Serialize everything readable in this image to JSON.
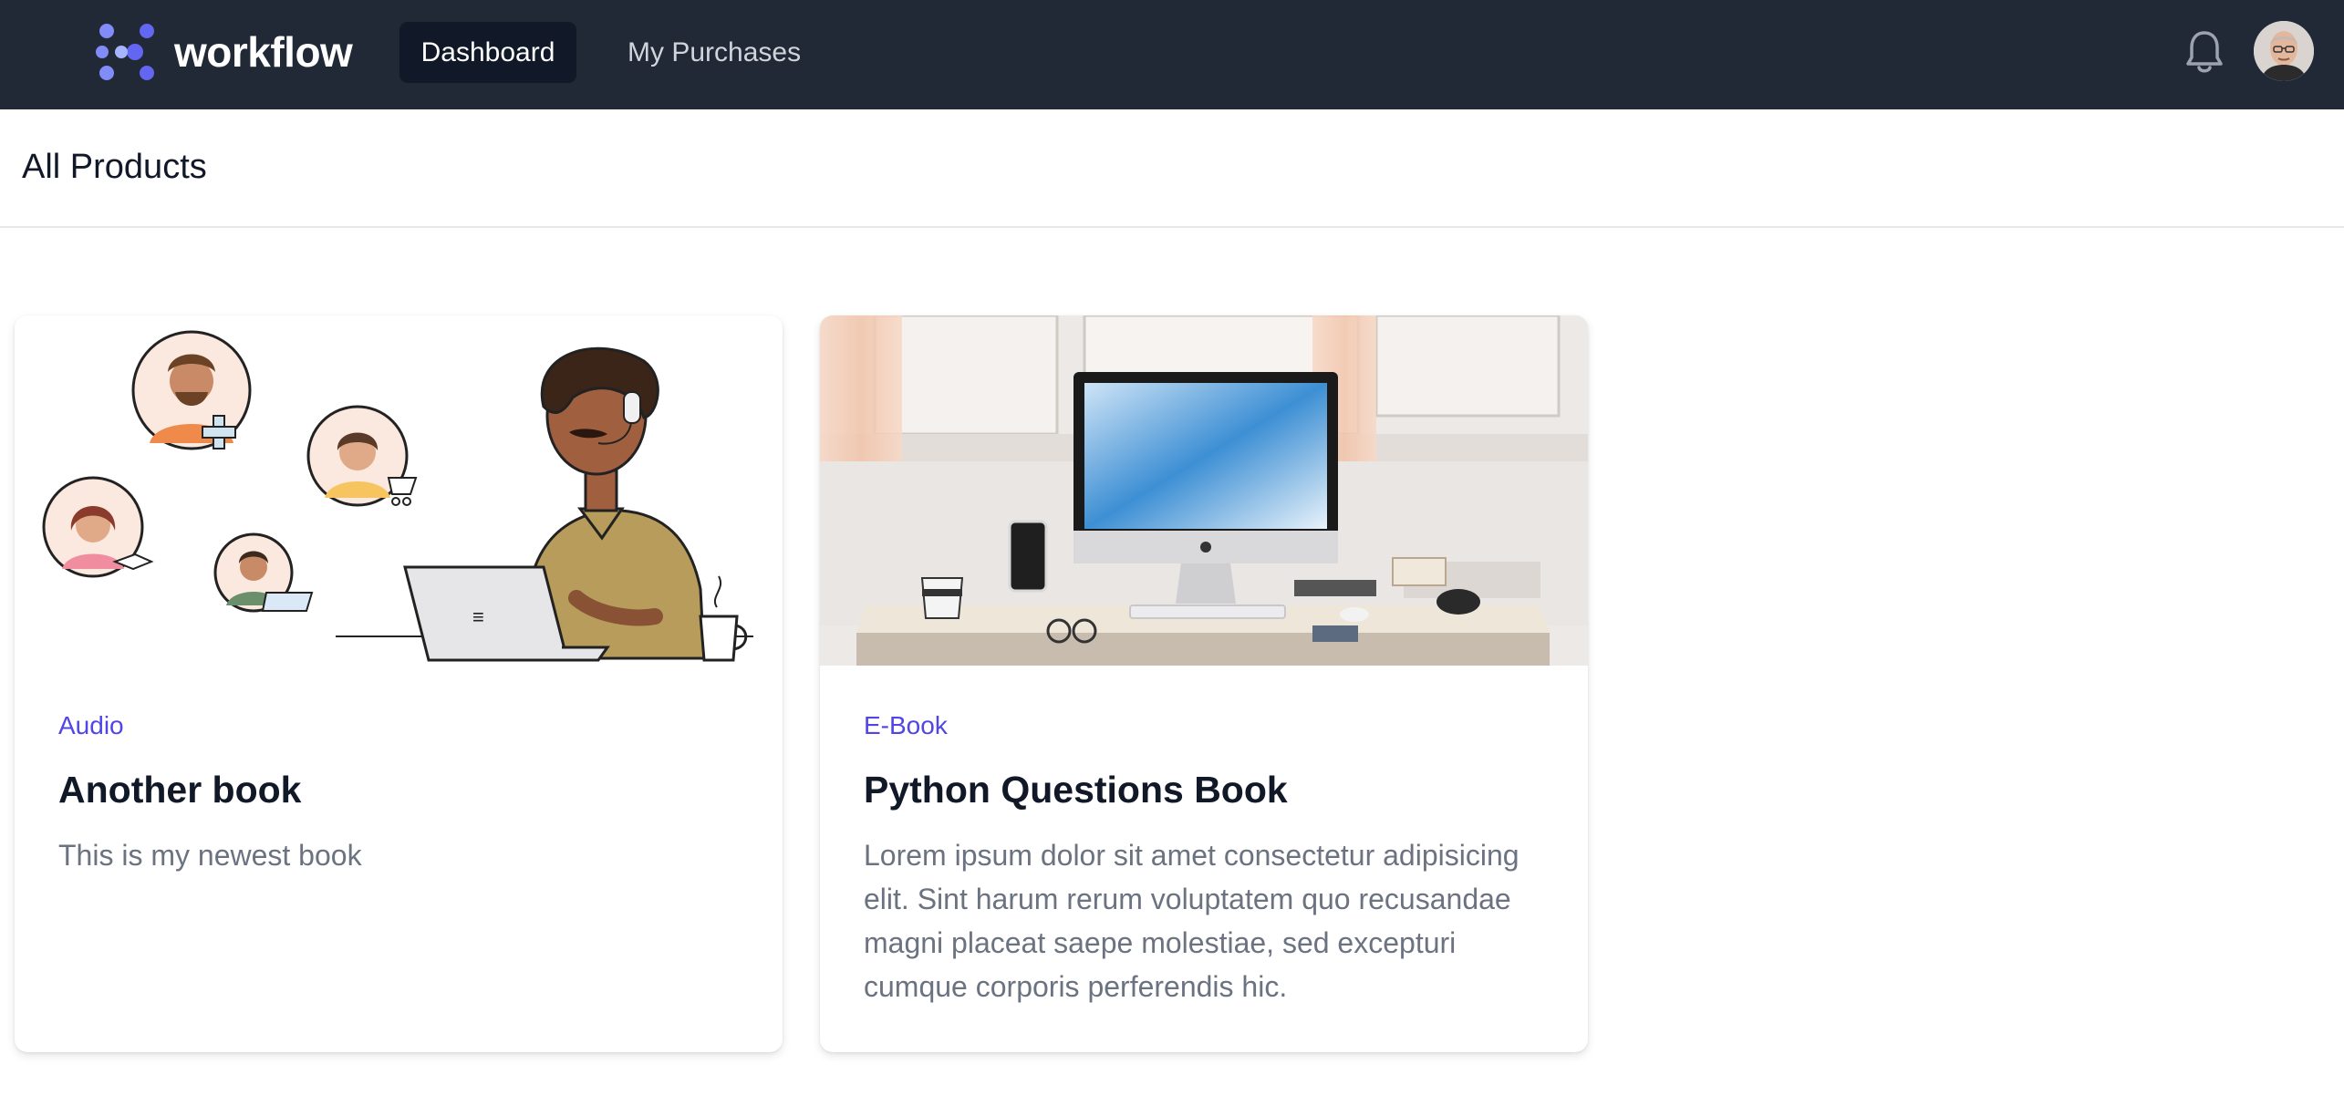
{
  "app": {
    "brand": "workflow",
    "accent_color": "#4f46e5",
    "nav_bg": "#212937"
  },
  "nav": {
    "links": [
      {
        "label": "Dashboard",
        "active": true
      },
      {
        "label": "My Purchases",
        "active": false
      }
    ],
    "icons": [
      "logo-icon",
      "bell-icon",
      "user-avatar"
    ]
  },
  "header": {
    "title": "All Products"
  },
  "products": [
    {
      "category": "Audio",
      "title": "Another book",
      "description": "This is my newest book",
      "image": "illustration-remote-work"
    },
    {
      "category": "E-Book",
      "title": "Python Questions Book",
      "description": "Lorem ipsum dolor sit amet consectetur adipisicing elit. Sint harum rerum voluptatem quo recusandae magni placeat saepe molestiae, sed excepturi cumque corporis perferendis hic.",
      "image": "photo-desk-computer"
    }
  ]
}
